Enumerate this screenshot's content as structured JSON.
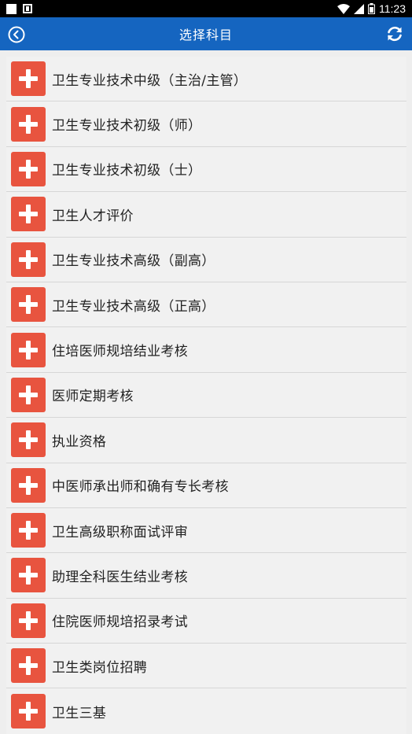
{
  "status_bar": {
    "time": "11:23",
    "icons": [
      "notification-square-icon",
      "sim-card-icon",
      "wifi-icon",
      "signal-icon",
      "battery-icon"
    ]
  },
  "app_bar": {
    "title": "选择科目",
    "back_icon": "back-circle-icon",
    "refresh_icon": "refresh-icon",
    "color": "#1565c0"
  },
  "accent": "#e8543f",
  "subjects": [
    {
      "label": "卫生专业技术中级（主治/主管）"
    },
    {
      "label": "卫生专业技术初级（师）"
    },
    {
      "label": "卫生专业技术初级（士）"
    },
    {
      "label": "卫生人才评价"
    },
    {
      "label": "卫生专业技术高级（副高）"
    },
    {
      "label": "卫生专业技术高级（正高）"
    },
    {
      "label": "住培医师规培结业考核"
    },
    {
      "label": "医师定期考核"
    },
    {
      "label": "执业资格"
    },
    {
      "label": "中医师承出师和确有专长考核"
    },
    {
      "label": "卫生高级职称面试评审"
    },
    {
      "label": "助理全科医生结业考核"
    },
    {
      "label": "住院医师规培招录考试"
    },
    {
      "label": "卫生类岗位招聘"
    },
    {
      "label": "卫生三基"
    }
  ]
}
